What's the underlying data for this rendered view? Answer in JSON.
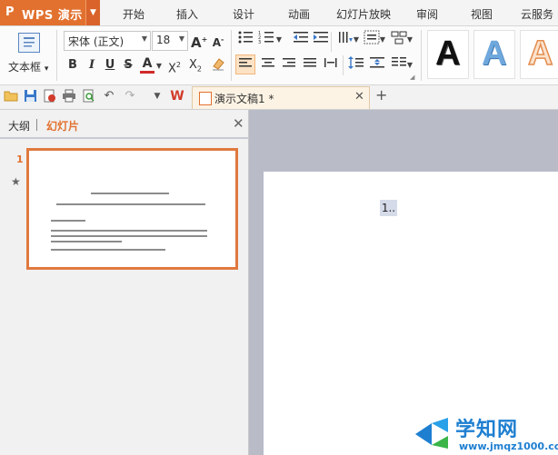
{
  "app": {
    "logo": "P",
    "name": "WPS 演示",
    "menu_caret": "▼"
  },
  "tabs": [
    "开始",
    "插入",
    "设计",
    "动画",
    "幻灯片放映",
    "审阅",
    "视图",
    "云服务"
  ],
  "ribbon": {
    "textbox_label": "文本框",
    "textbox_caret": "▾",
    "font_name": "宋体 (正文)",
    "font_size": "18",
    "grow_font": "A",
    "shrink_font": "A",
    "bold": "B",
    "italic": "I",
    "underline": "U",
    "strike": "S",
    "font_color": "A",
    "superscript": "X",
    "superscript_mark": "2",
    "subscript": "X",
    "subscript_mark": "2",
    "wordart_samples": [
      "A",
      "A",
      "A"
    ]
  },
  "document_tab": {
    "title": "演示文稿1 *"
  },
  "left_panel": {
    "tab_outline": "大纲",
    "tab_slides": "幻灯片",
    "slide_number": "1"
  },
  "canvas": {
    "placeholder_text": "1.."
  },
  "watermark": {
    "brand": "学知网",
    "url": "www.jmqz1000.com"
  },
  "colors": {
    "accent": "#e2712f",
    "canvas_bg": "#b9bcc7",
    "watermark": "#1e7fd1"
  },
  "icons": [
    "new-icon",
    "open-icon",
    "save-icon",
    "print-preview-icon",
    "print-icon",
    "undo-icon",
    "redo-icon",
    "wps-logo-icon",
    "close-icon",
    "add-tab-icon",
    "star-icon"
  ]
}
